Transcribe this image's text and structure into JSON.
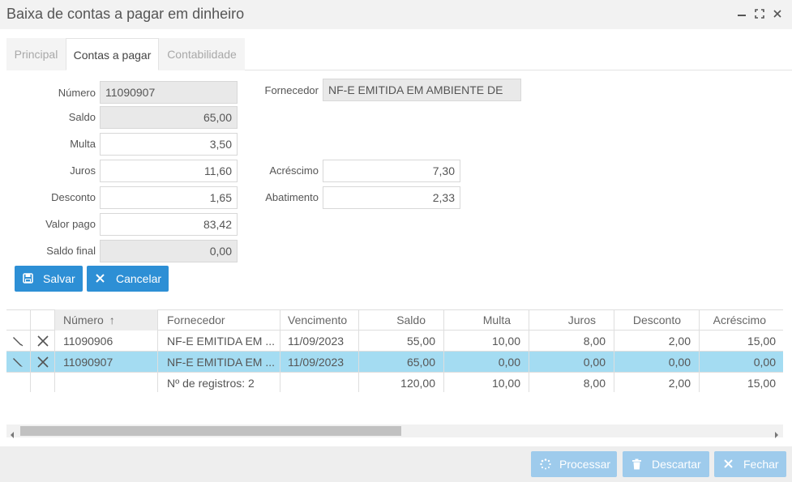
{
  "window": {
    "title": "Baixa de contas a pagar em dinheiro",
    "minimize_icon": "minimize-icon",
    "maximize_icon": "maximize-icon",
    "close_icon": "close-icon"
  },
  "tabs": [
    {
      "label": "Principal",
      "active": false
    },
    {
      "label": "Contas a pagar",
      "active": true
    },
    {
      "label": "Contabilidade",
      "active": false
    }
  ],
  "form": {
    "numero": {
      "label": "Número",
      "value": "11090907"
    },
    "saldo": {
      "label": "Saldo",
      "value": "65,00"
    },
    "multa": {
      "label": "Multa",
      "value": "3,50"
    },
    "juros": {
      "label": "Juros",
      "value": "11,60"
    },
    "desconto": {
      "label": "Desconto",
      "value": "1,65"
    },
    "valor_pago": {
      "label": "Valor pago",
      "value": "83,42"
    },
    "saldo_final": {
      "label": "Saldo final",
      "value": "0,00"
    },
    "fornecedor": {
      "label": "Fornecedor",
      "value": "NF-E EMITIDA EM AMBIENTE DE"
    },
    "acrescimo": {
      "label": "Acréscimo",
      "value": "7,30"
    },
    "abatimento": {
      "label": "Abatimento",
      "value": "2,33"
    }
  },
  "actions": {
    "salvar": "Salvar",
    "cancelar": "Cancelar"
  },
  "grid": {
    "columns": [
      "Número",
      "Fornecedor",
      "Vencimento",
      "Saldo",
      "Multa",
      "Juros",
      "Desconto",
      "Acréscimo"
    ],
    "sort_indicator": "↑",
    "rows": [
      {
        "numero": "11090906",
        "fornecedor": "NF-E EMITIDA EM ...",
        "vencimento": "11/09/2023",
        "saldo": "55,00",
        "multa": "10,00",
        "juros": "8,00",
        "desconto": "2,00",
        "acrescimo": "15,00",
        "selected": false
      },
      {
        "numero": "11090907",
        "fornecedor": "NF-E EMITIDA EM ...",
        "vencimento": "11/09/2023",
        "saldo": "65,00",
        "multa": "0,00",
        "juros": "0,00",
        "desconto": "0,00",
        "acrescimo": "0,00",
        "selected": true
      }
    ],
    "summary": {
      "label": "Nº de registros: 2",
      "saldo": "120,00",
      "multa": "10,00",
      "juros": "8,00",
      "desconto": "2,00",
      "acrescimo": "15,00"
    }
  },
  "footer": {
    "processar": "Processar",
    "descartar": "Descartar",
    "fechar": "Fechar"
  },
  "colors": {
    "primary_button": "#2d8fd5",
    "disabled_button": "#9ecbec",
    "selected_row": "#a4dcf2",
    "readonly_field": "#e9e9e9"
  }
}
